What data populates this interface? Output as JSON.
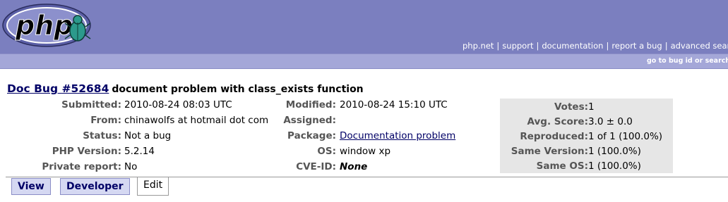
{
  "header": {
    "logo_text": "php",
    "nav": [
      "php.net",
      "support",
      "documentation",
      "report a bug",
      "advanced search"
    ],
    "goto_text": "go to bug id or search bugs for"
  },
  "bug": {
    "type_label": "Doc Bug",
    "number": "#52684",
    "summary": "document problem with class_exists function"
  },
  "details": {
    "submitted": {
      "label": "Submitted:",
      "value": "2010-08-24 08:03 UTC"
    },
    "from": {
      "label": "From:",
      "value": "chinawolfs at hotmail dot com"
    },
    "status": {
      "label": "Status:",
      "value": "Not a bug"
    },
    "php_version": {
      "label": "PHP Version:",
      "value": "5.2.14"
    },
    "private_report": {
      "label": "Private report:",
      "value": "No"
    },
    "modified": {
      "label": "Modified:",
      "value": "2010-08-24 15:10 UTC"
    },
    "assigned": {
      "label": "Assigned:",
      "value": ""
    },
    "package": {
      "label": "Package:",
      "value": "Documentation problem"
    },
    "os": {
      "label": "OS:",
      "value": "window xp"
    },
    "cve_id": {
      "label": "CVE-ID:",
      "value": "None"
    }
  },
  "votes": {
    "votes": {
      "label": "Votes:",
      "value": "1"
    },
    "avg_score": {
      "label": "Avg. Score:",
      "value": "3.0 ± 0.0"
    },
    "reproduced": {
      "label": "Reproduced:",
      "value": "1 of 1 (100.0%)"
    },
    "same_version": {
      "label": "Same Version:",
      "value": "1 (100.0%)"
    },
    "same_os": {
      "label": "Same OS:",
      "value": "1 (100.0%)"
    }
  },
  "tabs": [
    {
      "label": "View"
    },
    {
      "label": "Developer"
    },
    {
      "label": "Edit"
    }
  ],
  "colors": {
    "header_bg": "#7b7fbf",
    "subbar_bg": "#a4a7d8",
    "link": "#000066",
    "votes_bg": "#e6e6e6"
  }
}
